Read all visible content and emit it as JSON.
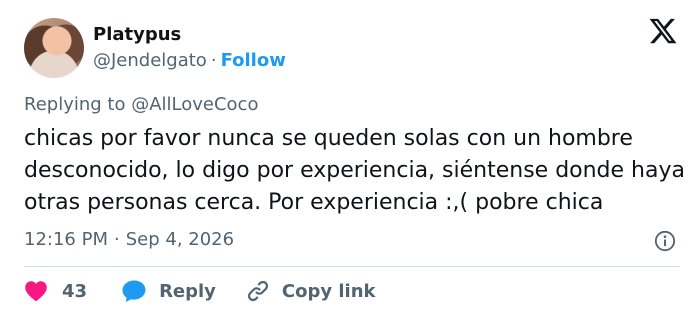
{
  "author": {
    "display_name": "Platypus",
    "handle": "@Jendelgato",
    "separator": "·",
    "follow_label": "Follow"
  },
  "replying_to": "Replying to @AllLoveCoco",
  "tweet": {
    "text": "chicas por favor nunca se queden solas con un hombre desconocido, lo digo por experiencia, siéntense donde haya otras personas cerca. Por experiencia :,( pobre chica"
  },
  "meta": {
    "time": "12:16 PM",
    "separator": "·",
    "date": "Sep 4, 2026"
  },
  "actions": {
    "like_count": "43",
    "reply_label": "Reply",
    "copy_link_label": "Copy link"
  },
  "icons": {
    "logo": "x-logo-icon",
    "info": "info-icon",
    "like": "heart-icon",
    "reply": "speech-bubble-icon",
    "copy": "link-icon"
  },
  "colors": {
    "link_blue": "#1d9bf0",
    "like_pink": "#f91880",
    "secondary_text": "#536471",
    "primary_text": "#0f1419",
    "divider": "#cfd9de"
  }
}
